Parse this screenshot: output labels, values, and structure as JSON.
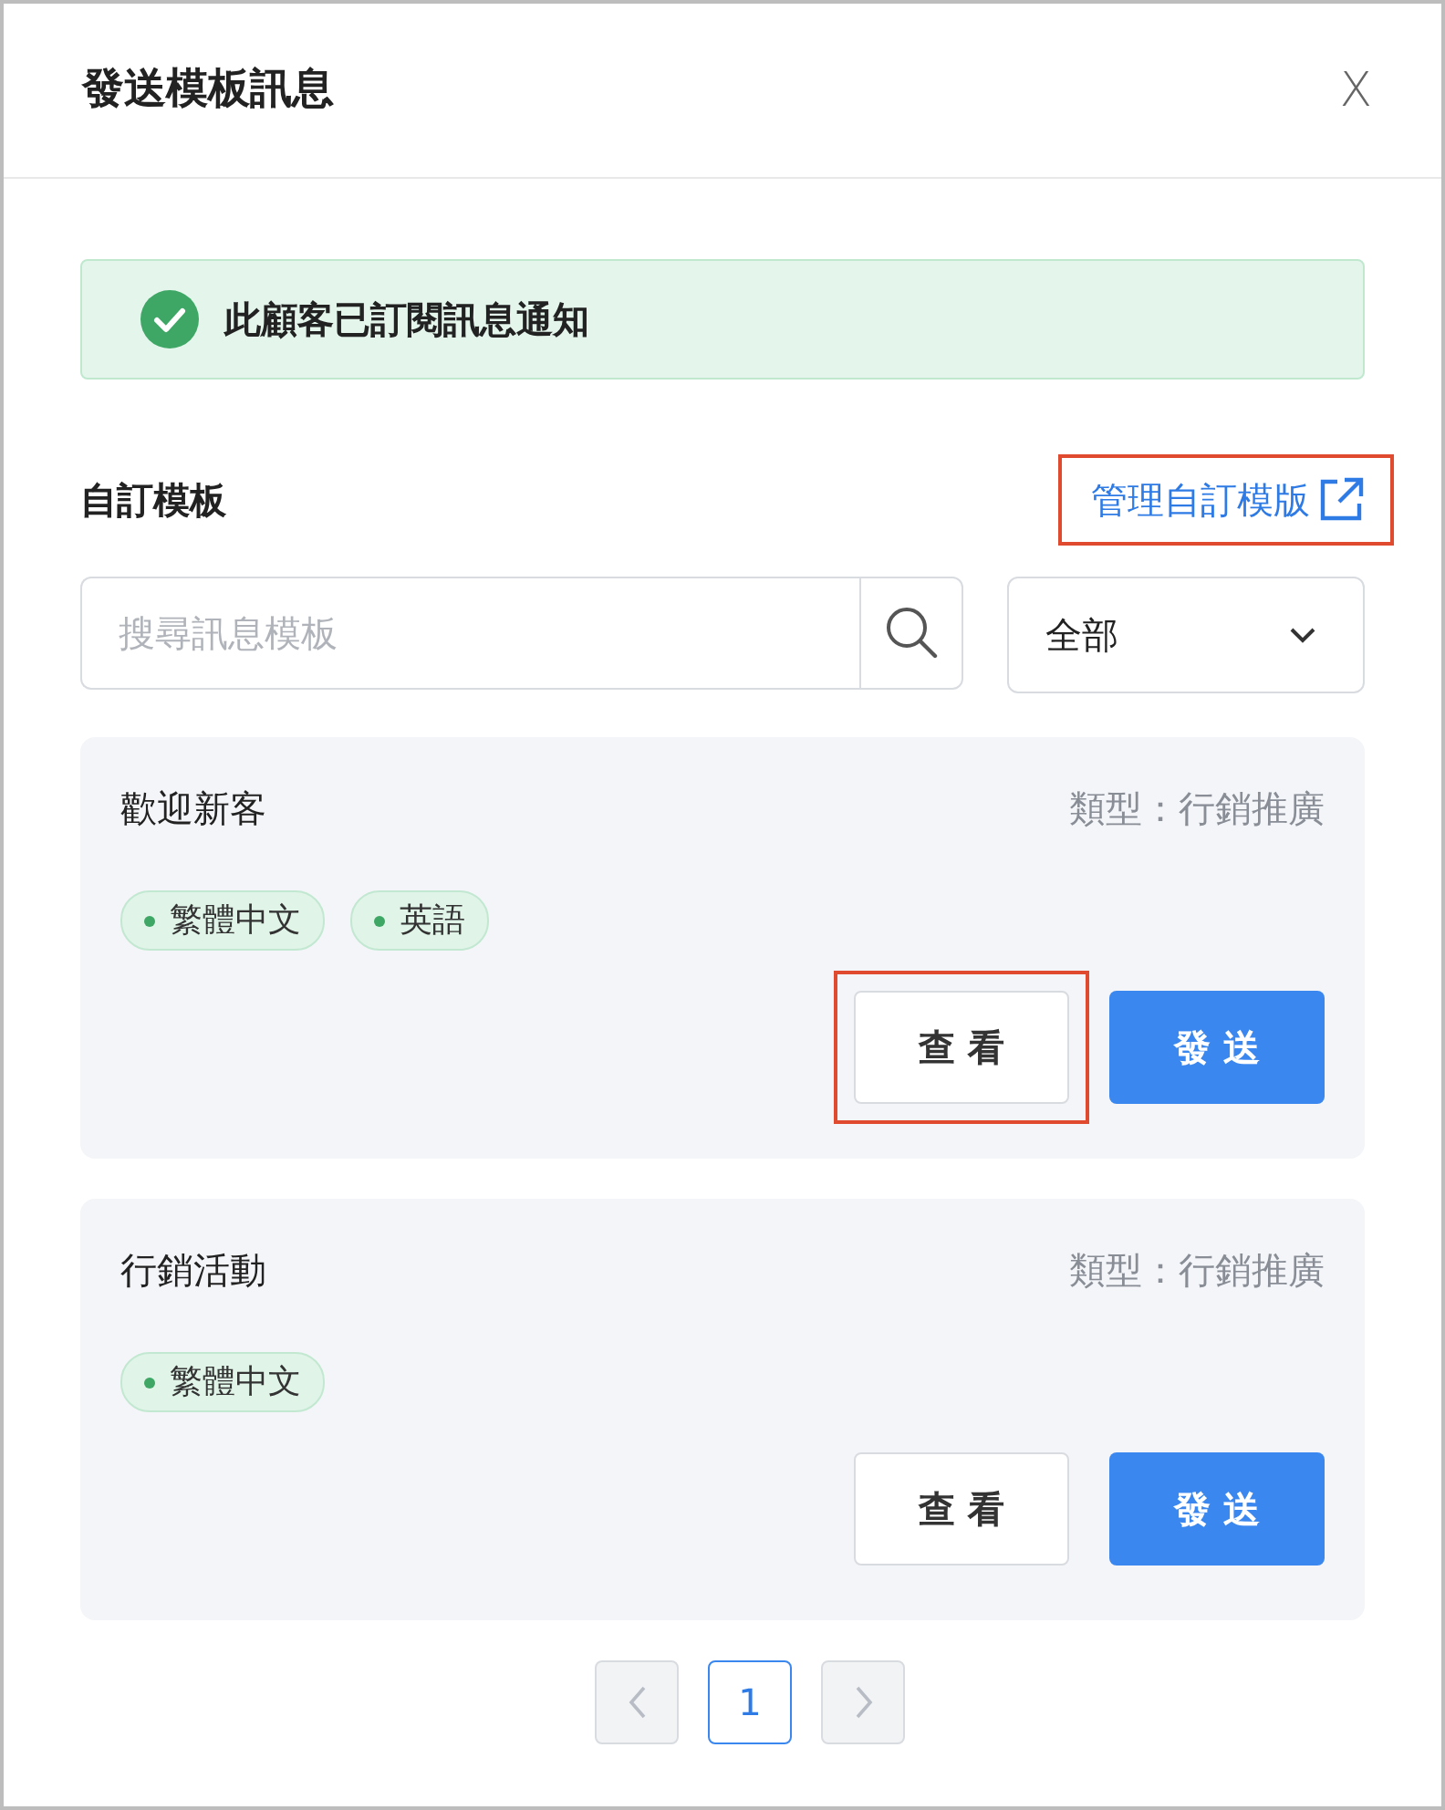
{
  "dialog": {
    "title": "發送模板訊息",
    "close": "X"
  },
  "alert": {
    "text": "此顧客已訂閱訊息通知"
  },
  "section": {
    "title": "自訂模板",
    "manage_link": {
      "label": "管理自訂模版",
      "highlighted": true
    }
  },
  "search": {
    "placeholder": "搜尋訊息模板"
  },
  "filter": {
    "value": "全部"
  },
  "templates": [
    {
      "name": "歡迎新客",
      "type": "類型：行銷推廣",
      "languages": [
        "繁體中文",
        "英語"
      ],
      "view": {
        "label": "查 看",
        "highlighted": true
      },
      "send": "發 送"
    },
    {
      "name": "行銷活動",
      "type": "類型：行銷推廣",
      "languages": [
        "繁體中文"
      ],
      "view": {
        "label": "查 看",
        "highlighted": false
      },
      "send": "發 送"
    }
  ],
  "pagination": {
    "prev_disabled": true,
    "next_disabled": true,
    "pages": [
      {
        "label": "1",
        "selected": true
      }
    ]
  }
}
